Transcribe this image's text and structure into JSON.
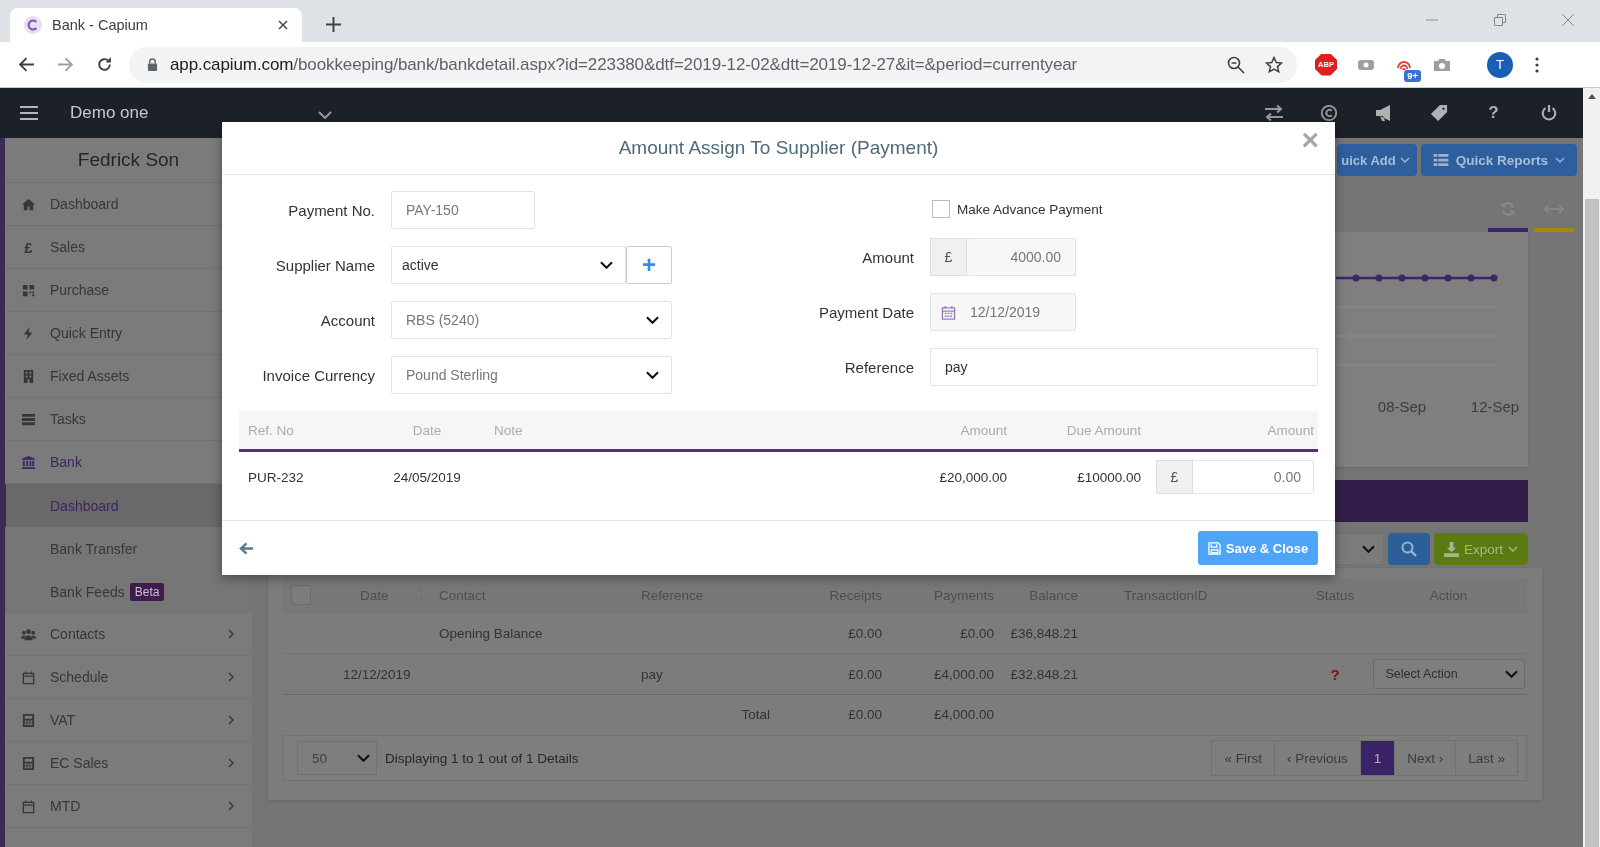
{
  "browser": {
    "tab_title": "Bank - Capium",
    "url_host": "app.capium.com",
    "url_path": "/bookkeeping/bank/bankdetail.aspx?id=223380&dtf=2019-12-02&dtt=2019-12-27&it=&period=currentyear",
    "adblock_label": "ABP",
    "extension_badge": "9+",
    "profile_initial": "T"
  },
  "app_header": {
    "company": "Demo one",
    "help": "?"
  },
  "sidebar": {
    "user": "Fedrick Son",
    "items": [
      {
        "label": "Dashboard",
        "expanded": false
      },
      {
        "label": "Sales",
        "glyph": "£",
        "expanded": false
      },
      {
        "label": "Purchase",
        "expanded": false
      },
      {
        "label": "Quick Entry",
        "expanded": false
      },
      {
        "label": "Fixed Assets",
        "expanded": false
      },
      {
        "label": "Tasks",
        "expanded": false
      },
      {
        "label": "Bank",
        "expanded": true,
        "children": [
          {
            "label": "Dashboard",
            "selected": true
          },
          {
            "label": "Bank Transfer",
            "selected": false
          },
          {
            "label": "Bank Feeds",
            "selected": false,
            "badge": "Beta"
          }
        ]
      },
      {
        "label": "Contacts",
        "has_submenu": true,
        "expanded": false
      },
      {
        "label": "Schedule",
        "has_submenu": true,
        "expanded": false
      },
      {
        "label": "VAT",
        "has_submenu": true,
        "expanded": false
      },
      {
        "label": "EC Sales",
        "has_submenu": true,
        "expanded": false
      },
      {
        "label": "MTD",
        "has_submenu": true,
        "expanded": false
      }
    ]
  },
  "toolbar": {
    "buttons": [
      "uick Add",
      "Quick Reports"
    ]
  },
  "chart": {
    "x_labels": [
      "08-Sep",
      "12-Sep"
    ]
  },
  "filter": {
    "export_label": "Export"
  },
  "transactions": {
    "select_all_checked": false,
    "columns": [
      "Date",
      "Contact",
      "Reference",
      "Receipts",
      "Payments",
      "Balance",
      "TransactionID",
      "Status",
      "Action"
    ],
    "rows": [
      {
        "contact": "Opening Balance",
        "receipts": "£0.00",
        "payments": "£0.00",
        "balance": "£36,848.21"
      },
      {
        "date": "12/12/2019",
        "reference": "pay",
        "receipts": "£0.00",
        "payments": "£4,000.00",
        "balance": "£32,848.21",
        "status": "?",
        "action": "Select Action"
      }
    ],
    "total": {
      "label": "Total",
      "receipts": "£0.00",
      "payments": "£4,000.00"
    }
  },
  "pagination": {
    "page_size": "50",
    "summary": "Displaying 1 to 1 out of 1 Details",
    "buttons": [
      {
        "label": "« First",
        "selected": false
      },
      {
        "label": "‹ Previous",
        "selected": false
      },
      {
        "label": "1",
        "selected": true
      },
      {
        "label": "Next ›",
        "selected": false
      },
      {
        "label": "Last »",
        "selected": false
      }
    ]
  },
  "modal": {
    "title": "Amount Assign To Supplier (Payment)",
    "close": "×",
    "fields_left": [
      {
        "kind": "text",
        "label": "Payment No.",
        "value": "PAY-150",
        "disabled": true
      },
      {
        "kind": "select",
        "label": "Supplier Name",
        "value": "active",
        "disabled": false,
        "add_button": "+"
      },
      {
        "kind": "select",
        "label": "Account",
        "value": "RBS (5240)",
        "disabled": true
      },
      {
        "kind": "select",
        "label": "Invoice Currency",
        "value": "Pound Sterling",
        "disabled": true
      }
    ],
    "advance_payment": {
      "label": "Make Advance Payment",
      "checked": false
    },
    "amount": {
      "label": "Amount",
      "currency": "£",
      "value": "4000.00",
      "disabled": true
    },
    "payment_date": {
      "label": "Payment Date",
      "value": "12/12/2019",
      "disabled": true
    },
    "reference": {
      "label": "Reference",
      "value": "pay",
      "disabled": false
    },
    "table": {
      "columns": [
        "Ref. No",
        "Date",
        "Note",
        "Amount",
        "Due Amount",
        "Amount"
      ],
      "rows": [
        {
          "ref_no": "PUR-232",
          "date": "24/05/2019",
          "amount": "£20,000.00",
          "due_amount": "£10000.00",
          "currency": "£",
          "assign_value": "0.00"
        }
      ]
    },
    "save_button": "Save & Close"
  }
}
